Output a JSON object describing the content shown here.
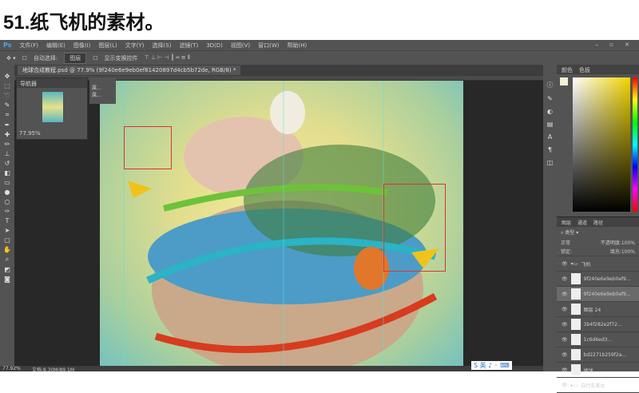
{
  "page_title": "51.纸飞机的素材。",
  "app": {
    "logo": "Ps",
    "menu": [
      "文件(F)",
      "编辑(E)",
      "图像(I)",
      "图层(L)",
      "文字(Y)",
      "选择(S)",
      "滤镜(T)",
      "3D(D)",
      "视图(V)",
      "窗口(W)",
      "帮助(H)"
    ],
    "window_controls": "– ▫ ✕"
  },
  "options": {
    "auto_select_label": "自动选择:",
    "auto_select_value": "图层",
    "show_transform": "显示变换控件"
  },
  "document_tab": "地球合成教程.psd @ 77.9% (9f240e6e9eb0ef81420897d4cb5b72de, RGB/8) *",
  "navigator": {
    "title": "导航器",
    "zoom": "77.95%"
  },
  "mini_panel": {
    "item1": "属...",
    "item2": "属..."
  },
  "color_panel": {
    "tabs": [
      "颜色",
      "色板"
    ]
  },
  "layers_panel": {
    "tabs": [
      "图层",
      "通道",
      "路径"
    ],
    "kind": "类型",
    "blend": "正常",
    "opacity_label": "不透明度:",
    "opacity": "100%",
    "lock_label": "锁定:",
    "fill_label": "填充:",
    "fill": "100%",
    "layers": [
      "飞机",
      "9f240e6e9eb0ef9...",
      "9f240e6e9eb0ef9...",
      "图层 24",
      "3b4f282e2f72...",
      "1c6d6ed3...",
      "bd2271b259f2a...",
      "地球",
      "自行车美女"
    ]
  },
  "status": {
    "zoom": "77.92%",
    "doc": "文档:8.30M/89.1M"
  },
  "ime": "S 英 ♪ ◦ ⌨"
}
